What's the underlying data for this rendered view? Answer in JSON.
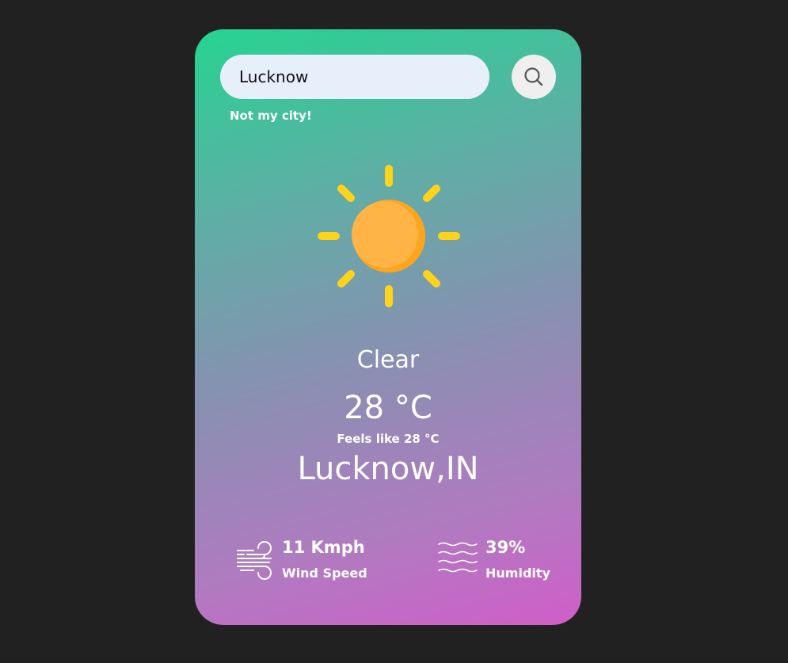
{
  "search": {
    "value": "Lucknow",
    "placeholder": ""
  },
  "not_my_city_label": "Not my city!",
  "weather": {
    "icon": "sun-icon",
    "condition": "Clear",
    "temperature": "28 °C",
    "feels_like": "Feels like 28 °C",
    "location": "Lucknow,IN"
  },
  "stats": {
    "wind": {
      "icon": "wind-icon",
      "value": "11 Kmph",
      "label": "Wind Speed"
    },
    "humidity": {
      "icon": "humidity-waves-icon",
      "value": "39%",
      "label": "Humidity"
    }
  },
  "colors": {
    "page_background": "#212121",
    "gradient_top": "#26d392",
    "gradient_bottom": "#d05ec8",
    "sun_core": "#ffb23f",
    "sun_rays": "#ffd31a"
  }
}
